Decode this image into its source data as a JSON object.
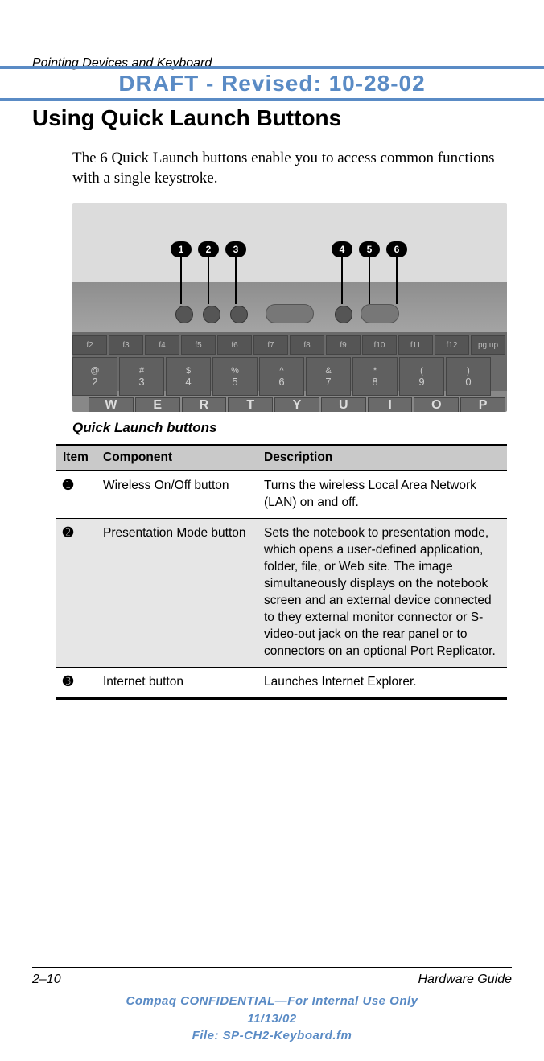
{
  "draft_banner": "DRAFT - Revised: 10-28-02",
  "running_head": "Pointing Devices and Keyboard",
  "heading": "Using Quick Launch Buttons",
  "intro": "The 6 Quick Launch buttons enable you to access common functions with a single keystroke.",
  "figure": {
    "callouts": [
      "1",
      "2",
      "3",
      "4",
      "5",
      "6"
    ],
    "fkeys": [
      "f2",
      "f3",
      "f4",
      "f5",
      "f6",
      "f7",
      "f8",
      "f9",
      "f10",
      "f11",
      "f12",
      "pg up"
    ],
    "numrow": [
      {
        "sym": "@",
        "num": "2"
      },
      {
        "sym": "#",
        "num": "3"
      },
      {
        "sym": "$",
        "num": "4"
      },
      {
        "sym": "%",
        "num": "5"
      },
      {
        "sym": "^",
        "num": "6"
      },
      {
        "sym": "&",
        "num": "7"
      },
      {
        "sym": "*",
        "num": "8"
      },
      {
        "sym": "(",
        "num": "9"
      },
      {
        "sym": ")",
        "num": "0"
      }
    ],
    "qwerty": [
      "W",
      "E",
      "R",
      "T",
      "Y",
      "U",
      "I",
      "O",
      "P"
    ],
    "caption": "Quick Launch buttons"
  },
  "table": {
    "headers": {
      "item": "Item",
      "component": "Component",
      "description": "Description"
    },
    "rows": [
      {
        "item": "➊",
        "component": "Wireless On/Off button",
        "description": "Turns the wireless Local Area Network (LAN) on and off."
      },
      {
        "item": "➋",
        "component": "Presentation Mode button",
        "description": "Sets the notebook to presentation mode, which opens a user-defined application, folder, file, or Web site. The image simultaneously displays on the notebook screen and an external device connected to they external monitor connector or S-video-out jack on the rear panel or to connectors on an optional Port Replicator."
      },
      {
        "item": "➌",
        "component": "Internet button",
        "description": "Launches Internet Explorer."
      }
    ]
  },
  "footer": {
    "page": "2–10",
    "doc": "Hardware Guide"
  },
  "confidential": {
    "line1": "Compaq CONFIDENTIAL—For Internal Use Only",
    "line2": "11/13/02",
    "line3": "File: SP-CH2-Keyboard.fm"
  }
}
